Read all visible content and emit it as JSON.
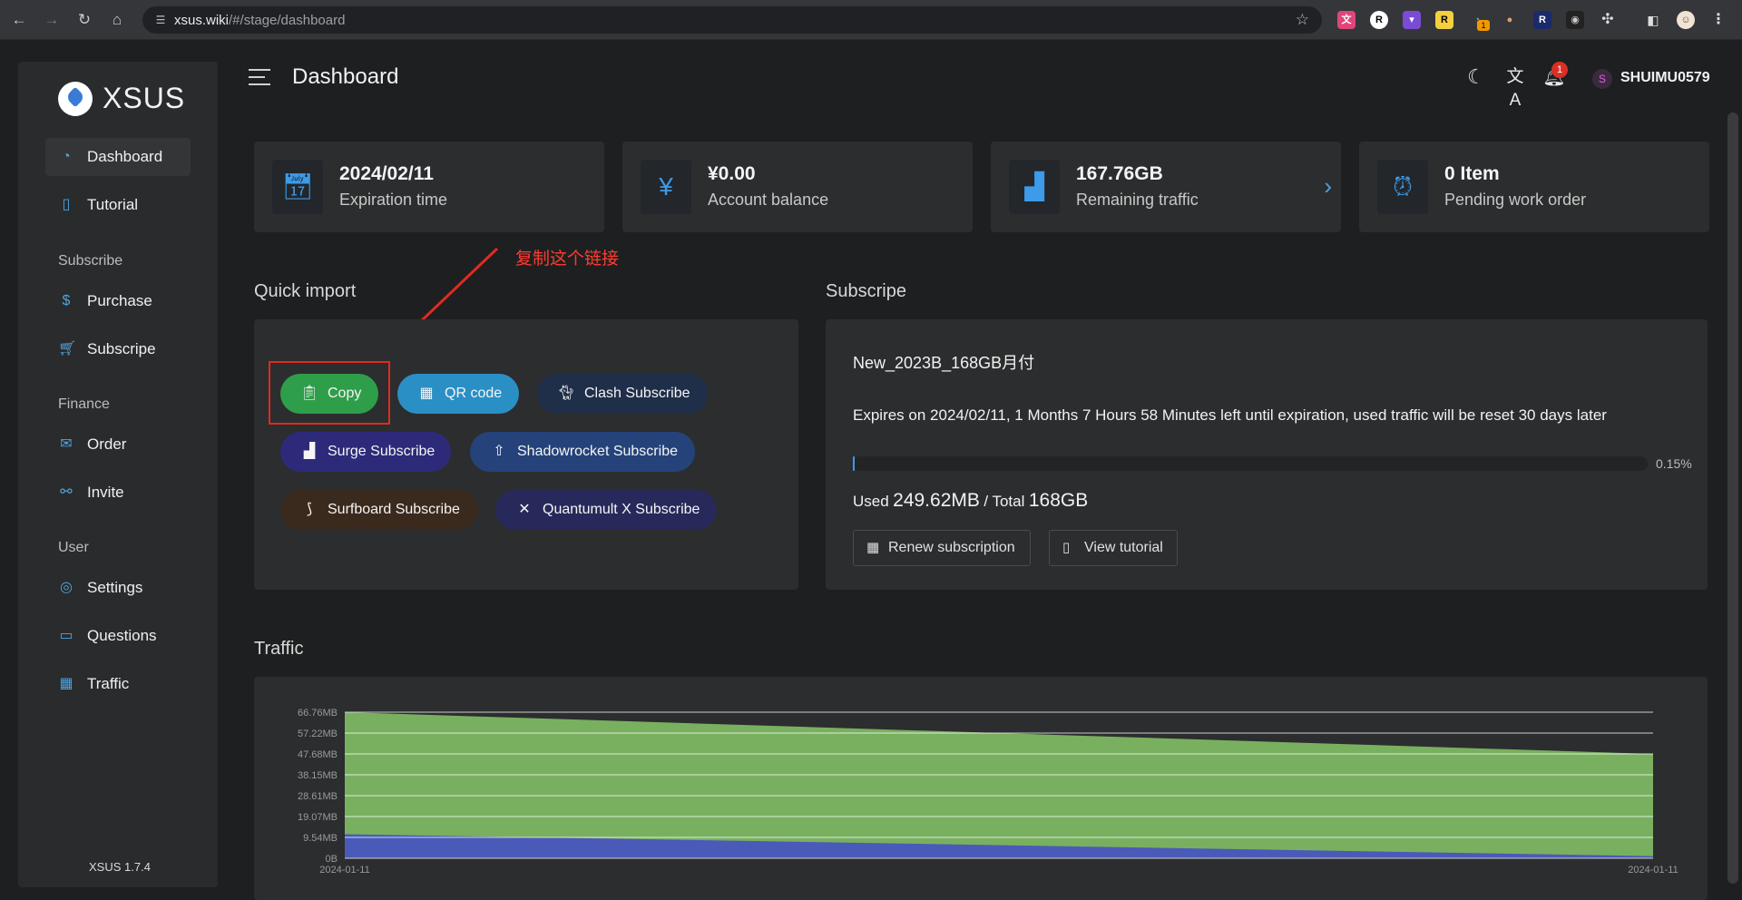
{
  "browser": {
    "url_host": "xsus.wiki",
    "url_path": "/#/stage/dashboard",
    "extension_badge": "1"
  },
  "app": {
    "brand": "XSUS",
    "version": "XSUS 1.7.4",
    "page_title": "Dashboard",
    "username": "SHUIMU0579",
    "avatar_letter": "S",
    "notification_count": "1"
  },
  "sidebar": {
    "items": [
      {
        "label": "Dashboard",
        "icon": "dashboard-icon"
      },
      {
        "label": "Tutorial",
        "icon": "book-icon"
      },
      {
        "label": "Purchase",
        "icon": "dollar-icon"
      },
      {
        "label": "Subscripe",
        "icon": "cart-icon"
      },
      {
        "label": "Order",
        "icon": "mail-icon"
      },
      {
        "label": "Invite",
        "icon": "link-icon"
      },
      {
        "label": "Settings",
        "icon": "user-circle-icon"
      },
      {
        "label": "Questions",
        "icon": "chat-icon"
      },
      {
        "label": "Traffic",
        "icon": "chart-board-icon"
      }
    ],
    "sections": [
      "Subscribe",
      "Finance",
      "User"
    ]
  },
  "stats": [
    {
      "value": "2024/02/11",
      "label": "Expiration time",
      "icon": "calendar-icon"
    },
    {
      "value": "¥0.00",
      "label": "Account balance",
      "icon": "yen-icon"
    },
    {
      "value": "167.76GB",
      "label": "Remaining traffic",
      "icon": "bar-chart-icon"
    },
    {
      "value": "0 Item",
      "label": "Pending work order",
      "icon": "alarm-clock-icon"
    }
  ],
  "annotation": "复制这个链接",
  "quick_import": {
    "title": "Quick import",
    "buttons": [
      {
        "label": "Copy",
        "color": "#2e9e4a"
      },
      {
        "label": "QR code",
        "color": "#2a8fc5"
      },
      {
        "label": "Clash Subscribe",
        "color": "#1f2f4a"
      },
      {
        "label": "Surge Subscribe",
        "color": "#2d2a7a"
      },
      {
        "label": "Shadowrocket Subscribe",
        "color": "#25437a"
      },
      {
        "label": "Surfboard Subscribe",
        "color": "#3a2a1e"
      },
      {
        "label": "Quantumult X Subscribe",
        "color": "#27295a"
      }
    ]
  },
  "subscription": {
    "title": "Subscripe",
    "plan_name": "New_2023B_168GB月付",
    "description": "Expires on 2024/02/11, 1 Months 7 Hours 58 Minutes left until expiration, used traffic will be reset 30 days later",
    "progress": 0.0015,
    "progress_label": "0.15%",
    "used_prefix": "Used",
    "used_value": "249.62MB",
    "total_prefix": "/ Total",
    "total_value": "168GB",
    "renew_label": "Renew subscription",
    "tutorial_label": "View tutorial"
  },
  "traffic": {
    "title": "Traffic"
  },
  "chart_data": {
    "type": "area",
    "title": "",
    "x": [
      "2024-01-11",
      "2024-01-11"
    ],
    "y_ticks": [
      "0B",
      "9.54MB",
      "19.07MB",
      "28.61MB",
      "38.15MB",
      "47.68MB",
      "57.22MB",
      "66.76MB"
    ],
    "ylim": [
      0,
      66.76
    ],
    "series": [
      {
        "values": [
          66.76,
          47.68
        ],
        "color": "#79b060"
      },
      {
        "values": [
          11.0,
          1.0
        ],
        "color": "#4a5ab8"
      }
    ],
    "grid": true
  }
}
